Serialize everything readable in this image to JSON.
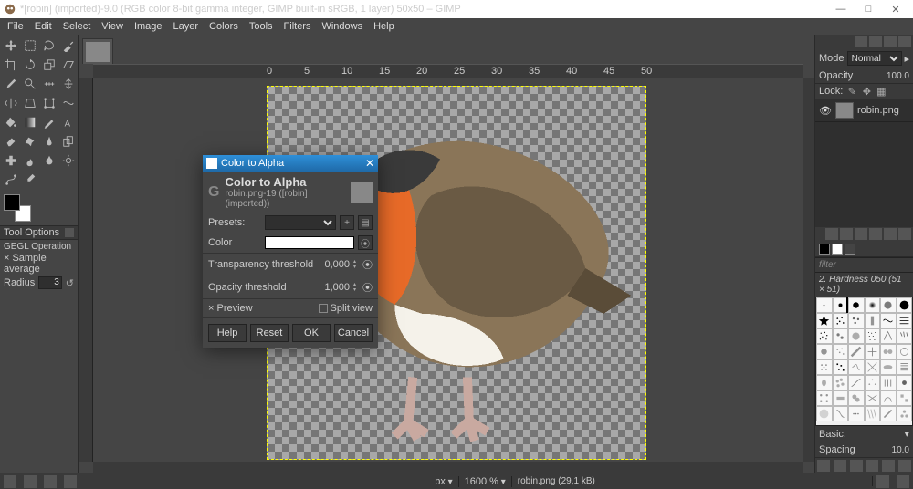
{
  "app": {
    "title": "*[robin] (imported)-9.0 (RGB color 8-bit gamma integer, GIMP built-in sRGB, 1 layer) 50x50 – GIMP"
  },
  "menu": [
    "File",
    "Edit",
    "Select",
    "View",
    "Image",
    "Layer",
    "Colors",
    "Tools",
    "Filters",
    "Windows",
    "Help"
  ],
  "toolopts": {
    "title": "Tool Options",
    "op_label": "GEGL Operation",
    "chk_sample": "Sample average",
    "radius_label": "Radius",
    "radius_value": "3"
  },
  "ruler_marks": [
    "0",
    "5",
    "10",
    "15",
    "20",
    "25",
    "30",
    "35",
    "40",
    "45",
    "50"
  ],
  "status": {
    "unit": "px",
    "zoom": "1600 %",
    "file": "robin.png (29,1 kB)"
  },
  "right": {
    "mode_label": "Mode",
    "mode_value": "Normal",
    "opacity_label": "Opacity",
    "opacity_value": "100.0",
    "lock_label": "Lock:",
    "layer_name": "robin.png",
    "filter_label": "filter",
    "brush_name": "2. Hardness 050 (51 × 51)",
    "basic_label": "Basic.",
    "spacing_label": "Spacing",
    "spacing_value": "10.0"
  },
  "dialog": {
    "wintitle": "Color to Alpha",
    "heading": "Color to Alpha",
    "sub": "robin.png-19 ([robin] (imported))",
    "presets_label": "Presets:",
    "color_label": "Color",
    "trans_label": "Transparency threshold",
    "trans_value": "0,000",
    "opac_label": "Opacity threshold",
    "opac_value": "1,000",
    "preview_label": "Preview",
    "split_label": "Split view",
    "btn_help": "Help",
    "btn_reset": "Reset",
    "btn_ok": "OK",
    "btn_cancel": "Cancel"
  }
}
